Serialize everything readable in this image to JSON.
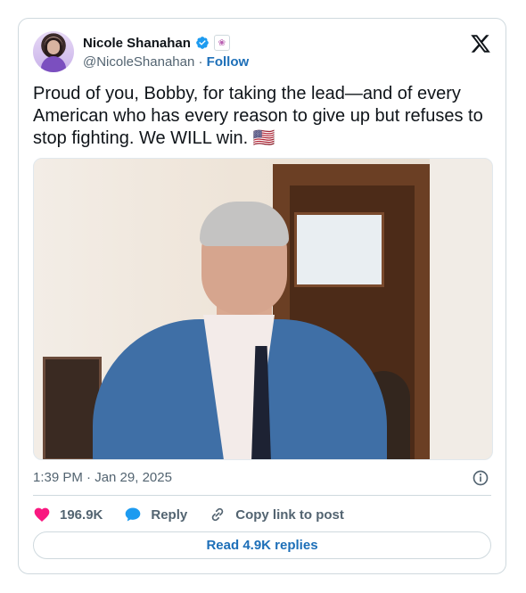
{
  "author": {
    "name": "Nicole Shanahan",
    "handle": "@NicoleShanahan",
    "separator": "·",
    "follow_label": "Follow"
  },
  "tweet": {
    "text": "Proud of you, Bobby, for taking the lead—and of every American who has every reason to give up but refuses to stop fighting. We WILL win. 🇺🇸",
    "timestamp": "1:39 PM · Jan 29, 2025"
  },
  "actions": {
    "likes": "196.9K",
    "reply_label": "Reply",
    "copy_link_label": "Copy link to post"
  },
  "read_replies_label": "Read 4.9K replies",
  "icons": {
    "verified": "verified-badge-icon",
    "affiliate": "affiliate-badge-icon",
    "platform": "x-logo-icon",
    "info": "info-icon",
    "like": "heart-icon",
    "reply": "reply-bubble-icon",
    "copy": "link-icon"
  },
  "colors": {
    "accent": "#1d9bf0",
    "like": "#f91880",
    "link": "#1d6fb8",
    "muted": "#536471"
  }
}
